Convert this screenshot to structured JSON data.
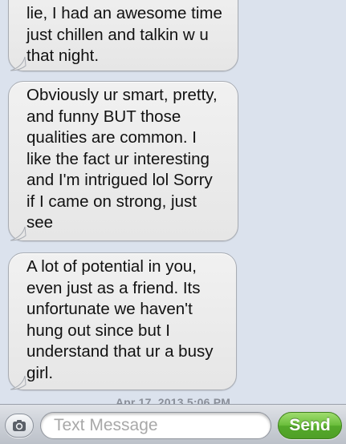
{
  "messages": [
    {
      "lines": [
        "lie, I had an awesome time",
        "just chillen and talkin w u",
        "that night."
      ]
    },
    {
      "lines": [
        "Obviously ur smart, pretty,",
        "and funny BUT those",
        "qualities are common. I",
        "like the fact ur interesting",
        "and I'm intrigued lol Sorry",
        "if I came on strong, just",
        "see"
      ]
    },
    {
      "lines": [
        "A lot of potential in you,",
        "even just as a friend. Its",
        "unfortunate we haven't",
        "hung out since but I",
        "understand that ur a busy",
        "girl."
      ]
    }
  ],
  "timestamp": "Apr 17, 2013 5:06 PM",
  "composer": {
    "camera_icon": "camera-icon",
    "placeholder": "Text Message",
    "value": "",
    "send_label": "Send"
  }
}
